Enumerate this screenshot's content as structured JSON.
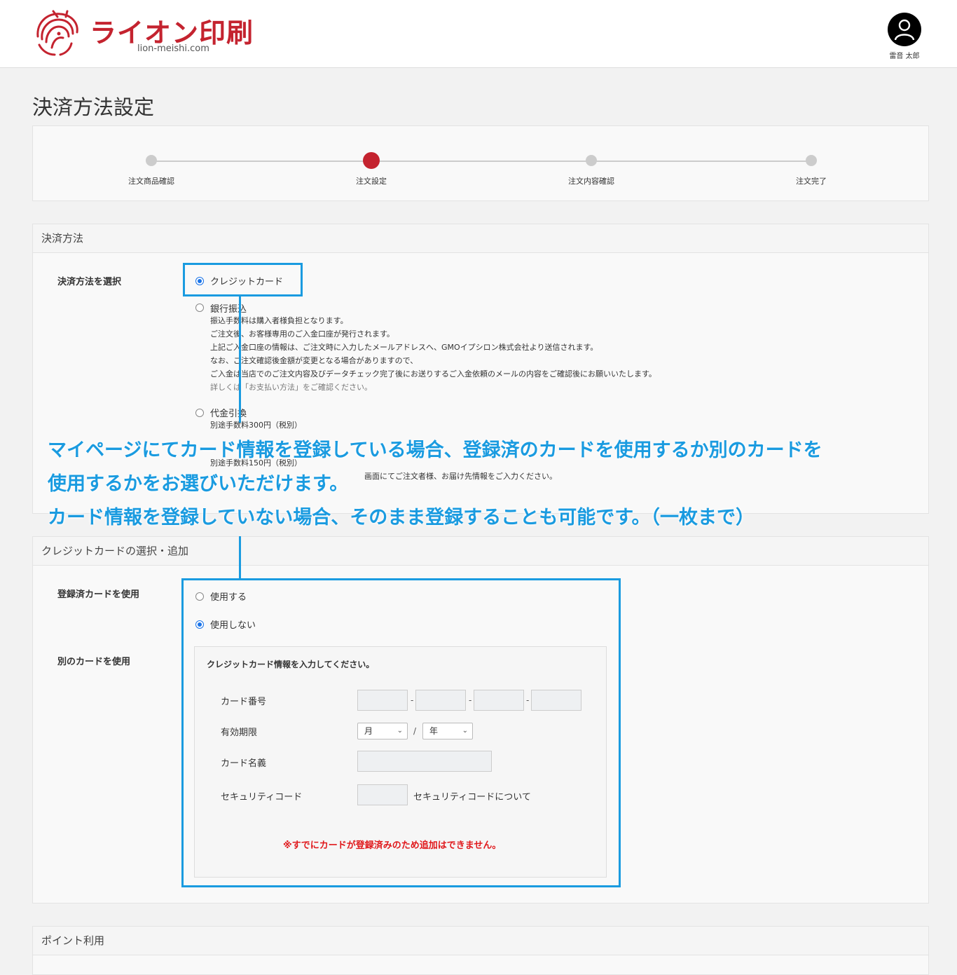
{
  "header": {
    "brand": "ライオン印刷",
    "domain": "lion-meishi.com",
    "user_name": "雷音 太郎",
    "brand_color": "#c4232f"
  },
  "page_title": "決済方法設定",
  "steps": [
    {
      "label": "注文商品確認",
      "active": false
    },
    {
      "label": "注文設定",
      "active": true
    },
    {
      "label": "注文内容確認",
      "active": false
    },
    {
      "label": "注文完了",
      "active": false
    }
  ],
  "payment": {
    "heading": "決済方法",
    "select_label": "決済方法を選択",
    "options": {
      "credit": {
        "label": "クレジットカード",
        "checked": true
      },
      "bank": {
        "label": "銀行振込",
        "checked": false,
        "notes": [
          "振込手数料は購入者様負担となります。",
          "ご注文後、お客様専用のご入金口座が発行されます。",
          "上記ご入金口座の情報は、ご注文時に入力したメールアドレスへ、GMOイプシロン株式会社より送信されます。",
          "なお、ご注文確認後金額が変更となる場合がありますので、",
          "ご入金は当店でのご注文内容及びデータチェック完了後にお送りするご入金依頼のメールの内容をご確認後にお願いいたします。",
          "詳しくは「お支払い方法」をご確認ください。"
        ]
      },
      "cod": {
        "label": "代金引換",
        "checked": false,
        "note": "別途手数料300円（税別）"
      },
      "other": {
        "note1": "別途手数料150円（税別）",
        "note2": "画面にてご注文者様、お届け先情報をご入力ください。"
      }
    }
  },
  "annotation": {
    "line1": "マイページにてカード情報を登録している場合、登録済のカードを使用するか別のカードを",
    "line2": "使用するかをお選びいただけます。",
    "line3": "カード情報を登録していない場合、そのまま登録することも可能です。（一枚まで）",
    "color": "#1a9be0"
  },
  "card": {
    "heading": "クレジットカードの選択・追加",
    "registered_label": "登録済カードを使用",
    "use_label": "使用する",
    "use_checked": false,
    "not_use_label": "使用しない",
    "not_use_checked": true,
    "other_card_label": "別のカードを使用",
    "form_title": "クレジットカード情報を入力してください。",
    "number_label": "カード番号",
    "expiry_label": "有効期限",
    "month_value": "月",
    "year_value": "年",
    "expiry_separator": "/",
    "number_separator": "-",
    "name_label": "カード名義",
    "cvc_label": "セキュリティコード",
    "cvc_help": "セキュリティコードについて",
    "warning": "※すでにカードが登録済みのため追加はできません。",
    "warning_color": "#e0181b"
  },
  "points": {
    "heading": "ポイント利用"
  }
}
